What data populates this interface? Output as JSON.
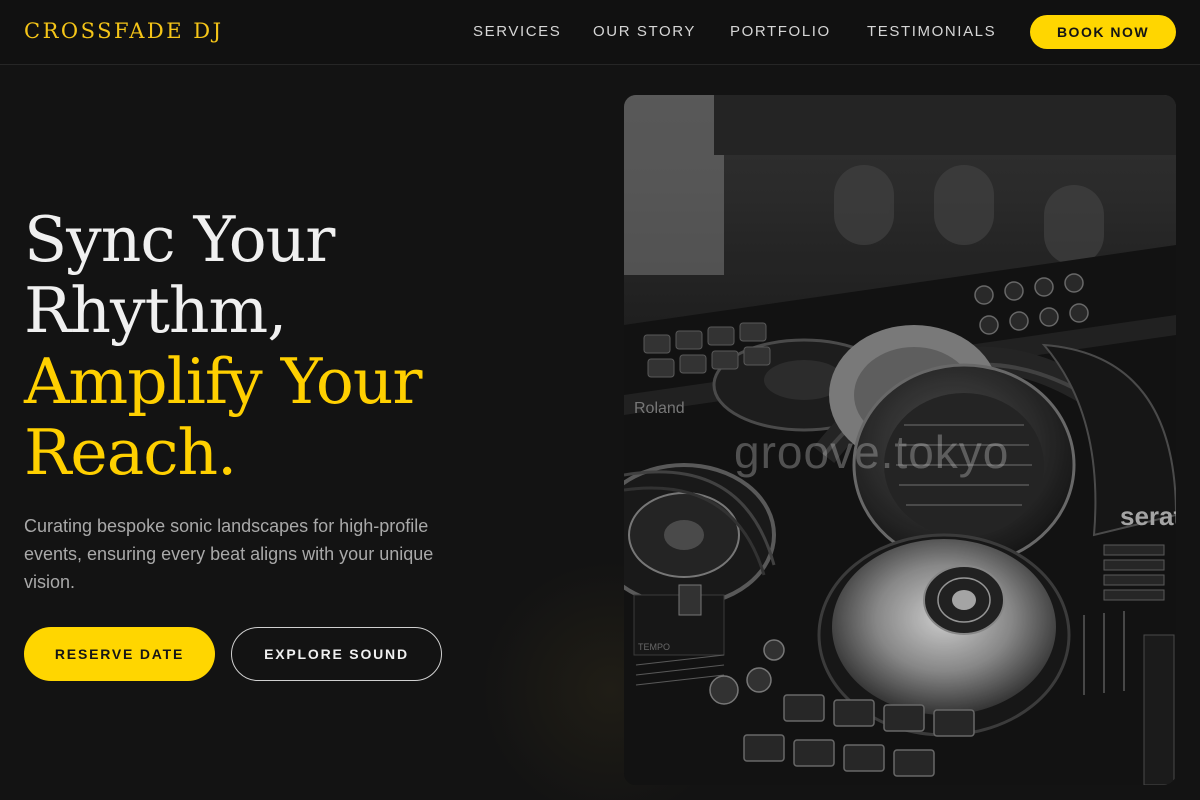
{
  "brand": {
    "name": "CROSSFADE DJ",
    "accent_color": "#ffd600"
  },
  "nav": {
    "items": [
      {
        "label": "SERVICES"
      },
      {
        "label": "OUR STORY"
      },
      {
        "label": "PORTFOLIO"
      },
      {
        "label": "TESTIMONIALS"
      }
    ],
    "cta_label": "BOOK NOW"
  },
  "hero": {
    "title_line1": "Sync Your",
    "title_line2": "Rhythm,",
    "title_line3": "Amplify Your",
    "title_line4": "Reach.",
    "description": "Curating bespoke sonic landscapes for high-profile events, ensuring every beat aligns with your unique vision.",
    "primary_button": "RESERVE DATE",
    "secondary_button": "EXPLORE SOUND",
    "image": {
      "subject": "dj-controller-with-headphones",
      "watermark": "groove.tokyo",
      "device_labels": {
        "brand_left": "Roland",
        "brand_right": "serato",
        "tempo": "TEMPO"
      }
    }
  }
}
